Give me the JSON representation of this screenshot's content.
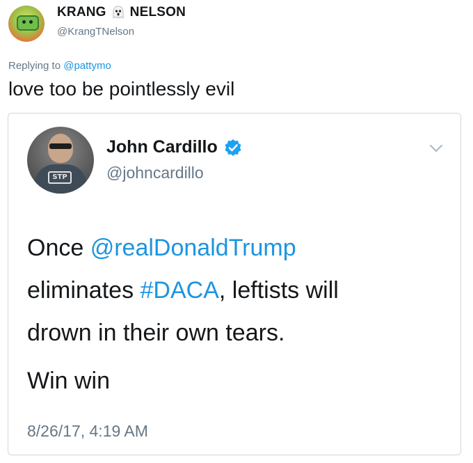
{
  "outer_tweet": {
    "name_part1": "KRANG",
    "name_part2": "NELSON",
    "ghost_icon": "ghost-emoji-icon",
    "handle": "@KrangTNelson",
    "reply_prefix": "Replying to",
    "reply_handle": "@pattymo",
    "text": "love too be pointlessly evil"
  },
  "quoted_tweet": {
    "name": "John Cardillo",
    "verified_icon": "verified-badge-icon",
    "handle": "@johncardillo",
    "avatar_logo_text": "STP",
    "menu_icon": "chevron-down-icon",
    "text_once": "Once ",
    "mention": "@realDonaldTrump",
    "text_line2_prefix": "eliminates ",
    "hashtag": "#DACA",
    "text_line2_suffix": ", leftists will",
    "text_line3": "drown in their own tears.",
    "text_second_paragraph": "Win win",
    "timestamp": "8/26/17, 4:19 AM"
  },
  "colors": {
    "link": "#1b95e0",
    "secondary_text": "#657786",
    "primary_text": "#14171a",
    "card_border": "#d0d7dd"
  }
}
